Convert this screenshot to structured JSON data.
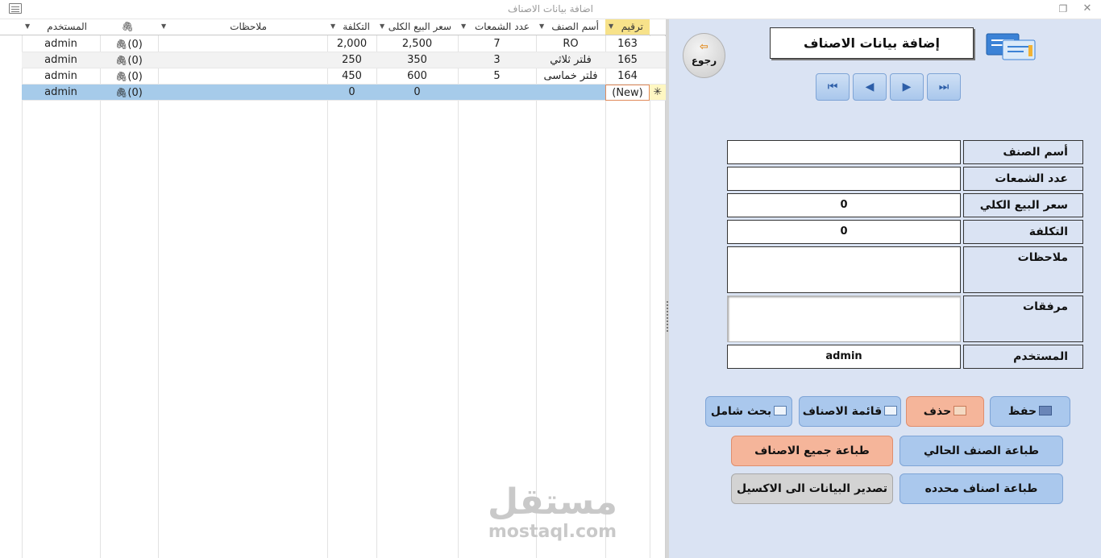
{
  "window": {
    "title": "اضافة بيانات الاصناف"
  },
  "grid": {
    "columns": [
      {
        "label": "ترقيم"
      },
      {
        "label": "أسم الصنف"
      },
      {
        "label": "عدد الشمعات"
      },
      {
        "label": "سعر البيع الكلى"
      },
      {
        "label": "التكلفة"
      },
      {
        "label": "ملاحظات"
      },
      {
        "label": ""
      },
      {
        "label": "المستخدم"
      }
    ],
    "rows": [
      {
        "id": "163",
        "name": "RO",
        "candles": "7",
        "price": "2,500",
        "cost": "2,000",
        "notes": "",
        "attach": "(0)",
        "user": "admin"
      },
      {
        "id": "165",
        "name": "فلتر ثلاثي",
        "candles": "3",
        "price": "350",
        "cost": "250",
        "notes": "",
        "attach": "(0)",
        "user": "admin"
      },
      {
        "id": "164",
        "name": "فلتر خماسى",
        "candles": "5",
        "price": "600",
        "cost": "450",
        "notes": "",
        "attach": "(0)",
        "user": "admin"
      }
    ],
    "new_row": {
      "id": "(New)",
      "price": "0",
      "cost": "0",
      "attach": "(0)",
      "user": "admin"
    },
    "new_marker": "✳"
  },
  "watermark": {
    "arabic": "مستقل",
    "latin": "mostaql.com"
  },
  "form": {
    "title": "إضافة بيانات الاصناف",
    "back_label": "رجوع",
    "fields": [
      {
        "label": "أسم الصنف",
        "value": ""
      },
      {
        "label": "عدد الشمعات",
        "value": ""
      },
      {
        "label": "سعر البيع الكلي",
        "value": "0"
      },
      {
        "label": "التكلفة",
        "value": "0"
      },
      {
        "label": "ملاحظات",
        "value": ""
      },
      {
        "label": "مرفقات",
        "value": ""
      },
      {
        "label": "المستخدم",
        "value": "admin"
      }
    ],
    "buttons": {
      "save": "حفظ",
      "delete": "حذف",
      "items_list": "قائمة الاصناف",
      "search": "بحث شامل",
      "print_current": "طباعة الصنف الحالي",
      "print_all": "طباعة جميع الاصناف",
      "print_selected": "طباعة اصناف محدده",
      "export_excel": "تصدير البيانات الى الاكسيل"
    },
    "nav_icons": [
      "first-record-icon",
      "previous-record-icon",
      "next-record-icon",
      "last-record-icon"
    ]
  },
  "colors": {
    "form_bg": "#dae3f3",
    "button_blue": "#aac8ed",
    "button_orange": "#f5b59a",
    "button_grey": "#d3d3d3",
    "new_row_highlight": "#a6cbea",
    "active_header": "#f7e28a"
  }
}
